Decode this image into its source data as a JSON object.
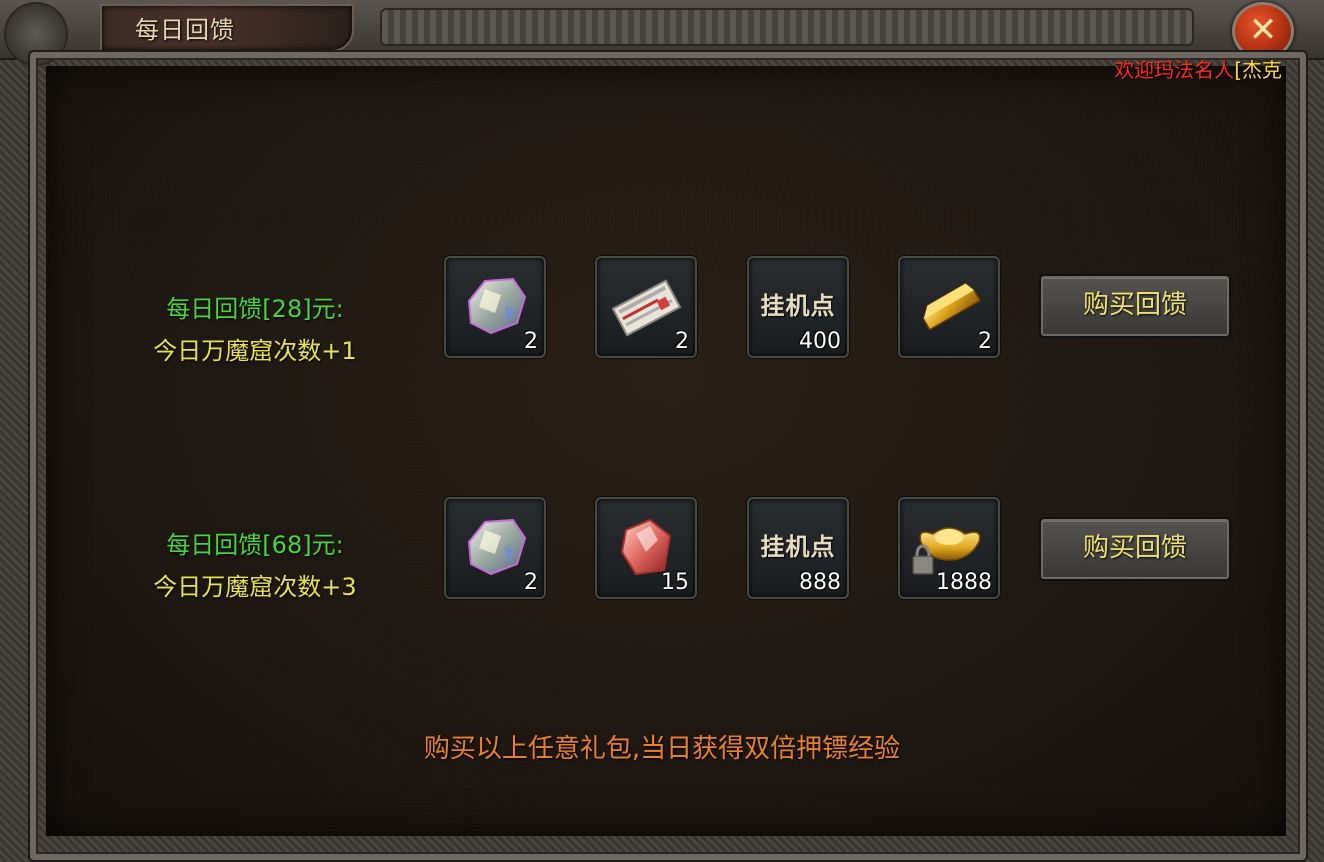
{
  "window": {
    "title": "每日回馈",
    "welcome_prefix": "欢迎玛法名人",
    "welcome_name": "[杰克"
  },
  "packages": [
    {
      "price_label": "每日回馈[28]元:",
      "bonus_label": "今日万魔窟次数+1",
      "items": [
        {
          "icon": "ore-crystal-icon",
          "text": "",
          "count": "2"
        },
        {
          "icon": "scroll-ticket-icon",
          "text": "",
          "count": "2"
        },
        {
          "icon": "idle-points-icon",
          "text": "挂机点",
          "count": "400"
        },
        {
          "icon": "gold-bar-icon",
          "text": "",
          "count": "2"
        }
      ],
      "button_label": "购买回馈"
    },
    {
      "price_label": "每日回馈[68]元:",
      "bonus_label": "今日万魔窟次数+3",
      "items": [
        {
          "icon": "ore-crystal-icon",
          "text": "",
          "count": "2"
        },
        {
          "icon": "red-gem-icon",
          "text": "",
          "count": "15"
        },
        {
          "icon": "idle-points-icon",
          "text": "挂机点",
          "count": "888"
        },
        {
          "icon": "locked-gold-ingot-icon",
          "text": "",
          "count": "1888"
        }
      ],
      "button_label": "购买回馈"
    }
  ],
  "footer_note": "购买以上任意礼包,当日获得双倍押镖经验",
  "colors": {
    "price_green": "#49d43a",
    "bonus_yellow": "#e8e450",
    "note_orange": "#e8822a",
    "welcome_red": "#ff2a1a"
  }
}
